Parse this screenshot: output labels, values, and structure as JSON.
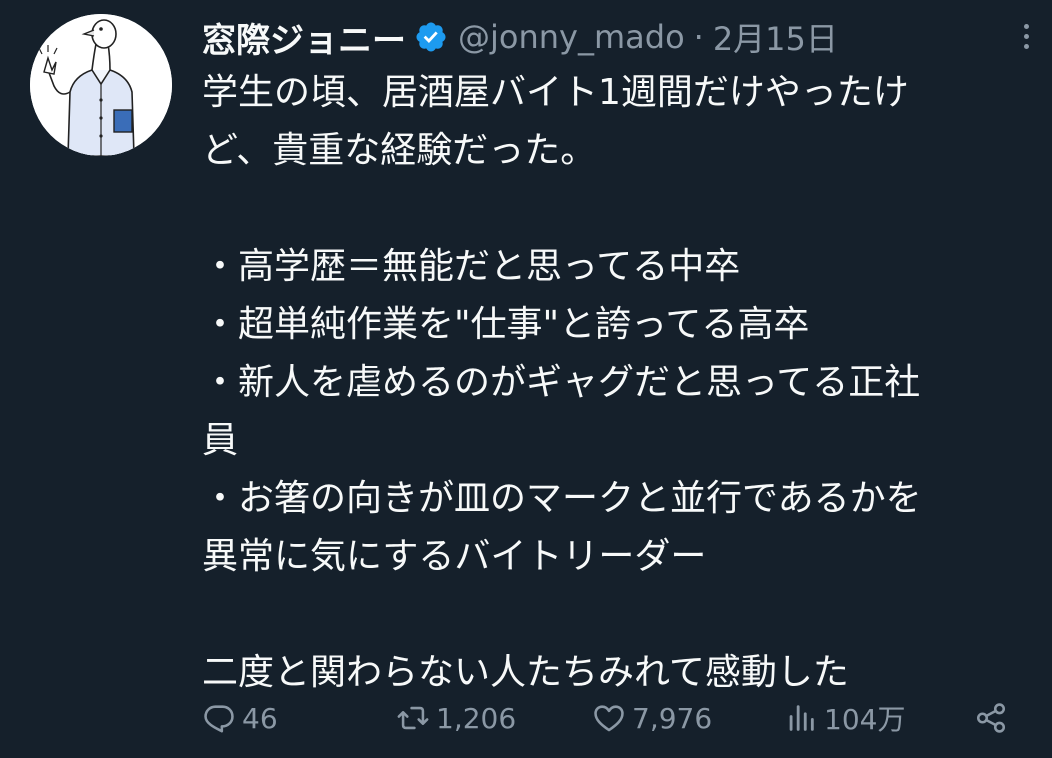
{
  "author": {
    "display_name": "窓際ジョニー",
    "handle": "@jonny_mado",
    "separator": "·",
    "date": "2月15日",
    "avatar_icon": "pigeon-office-worker-avatar",
    "verified_icon": "verified-badge-icon",
    "verified_color": "#1d9bf0"
  },
  "tweet": {
    "lines": [
      "学生の頃、居酒屋バイト1週間だけやったけ",
      "ど、貴重な経験だった。",
      "",
      "・高学歴＝無能だと思ってる中卒",
      "・超単純作業を\"仕事\"と誇ってる高卒",
      "・新人を虐めるのがギャグだと思ってる正社",
      "員",
      "・お箸の向きが皿のマークと並行であるかを",
      "異常に気にするバイトリーダー",
      "",
      "二度と関わらない人たちみれて感動した"
    ]
  },
  "actions": {
    "reply_count": "46",
    "retweet_count": "1,206",
    "like_count": "7,976",
    "views_count": "104万"
  },
  "colors": {
    "background": "#15202b",
    "text": "#f7f9f9",
    "muted": "#8b98a5"
  }
}
